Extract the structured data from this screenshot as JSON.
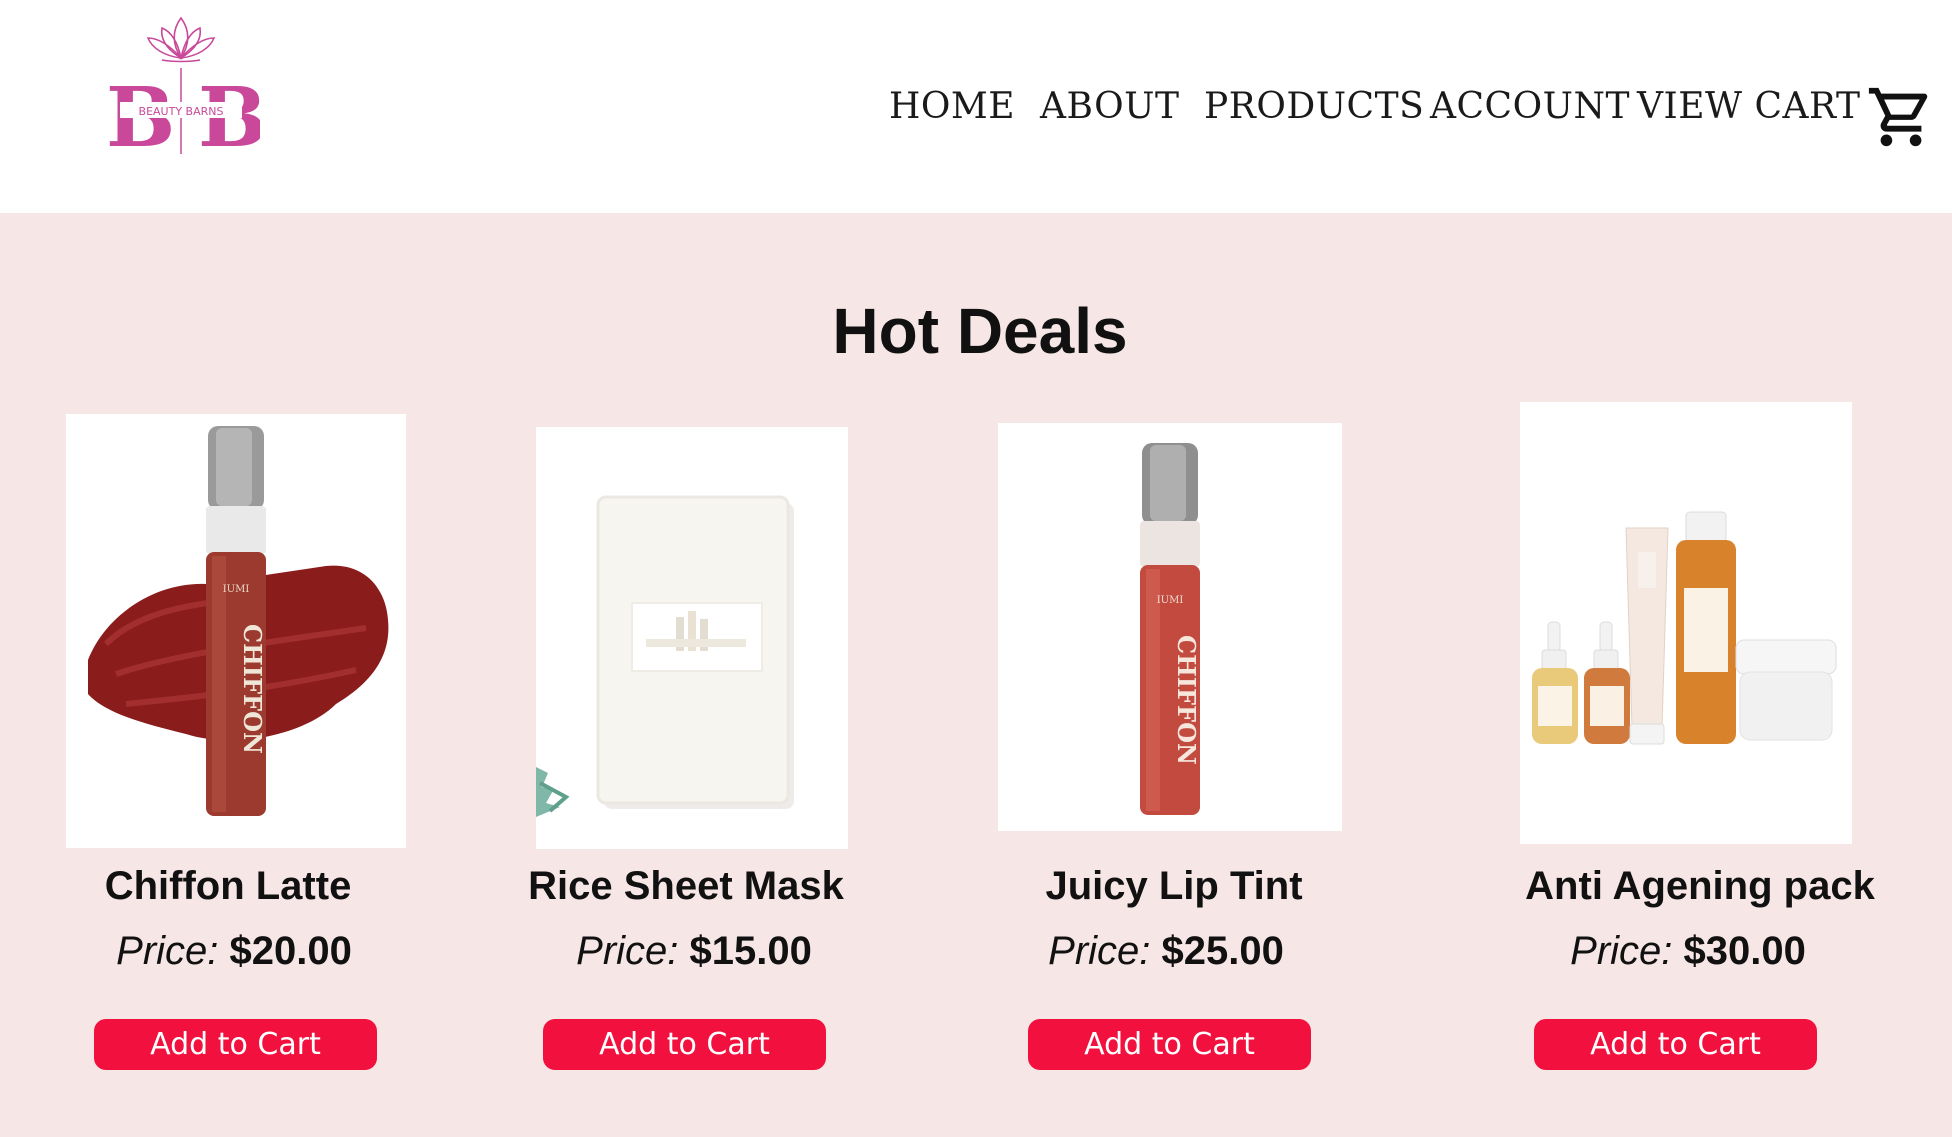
{
  "brand": {
    "monogram_left": "B",
    "monogram_right": "B",
    "logo_text": "BEAUTY BARNS",
    "color": "#c9489a"
  },
  "nav": {
    "items": [
      {
        "label": "HOME"
      },
      {
        "label": "ABOUT"
      },
      {
        "label": "PRODUCTS"
      },
      {
        "label": "ACCOUNT"
      },
      {
        "label": "VIEW CART"
      }
    ],
    "cart_icon": "shopping-cart-icon"
  },
  "main": {
    "title": "Hot Deals",
    "background": "#f7e6e6"
  },
  "products": [
    {
      "name": "Chiffon Latte",
      "price_label": "Price:",
      "price": "$20.00",
      "button": "Add to Cart",
      "image": "chiffon-latte-lip-tint-image",
      "product_text": "CHIFFON"
    },
    {
      "name": "Rice Sheet Mask",
      "price_label": "Price:",
      "price": "$15.00",
      "button": "Add to Cart",
      "image": "rice-sheet-mask-image"
    },
    {
      "name": "Juicy Lip Tint",
      "price_label": "Price:",
      "price": "$25.00",
      "button": "Add to Cart",
      "image": "juicy-lip-tint-image",
      "product_text": "CHIFFON"
    },
    {
      "name": "Anti Agening pack",
      "price_label": "Price:",
      "price": "$30.00",
      "button": "Add to Cart",
      "image": "anti-ageing-pack-image"
    }
  ],
  "colors": {
    "button": "#f2113e",
    "button_text": "#ffffff",
    "text": "#111111"
  }
}
